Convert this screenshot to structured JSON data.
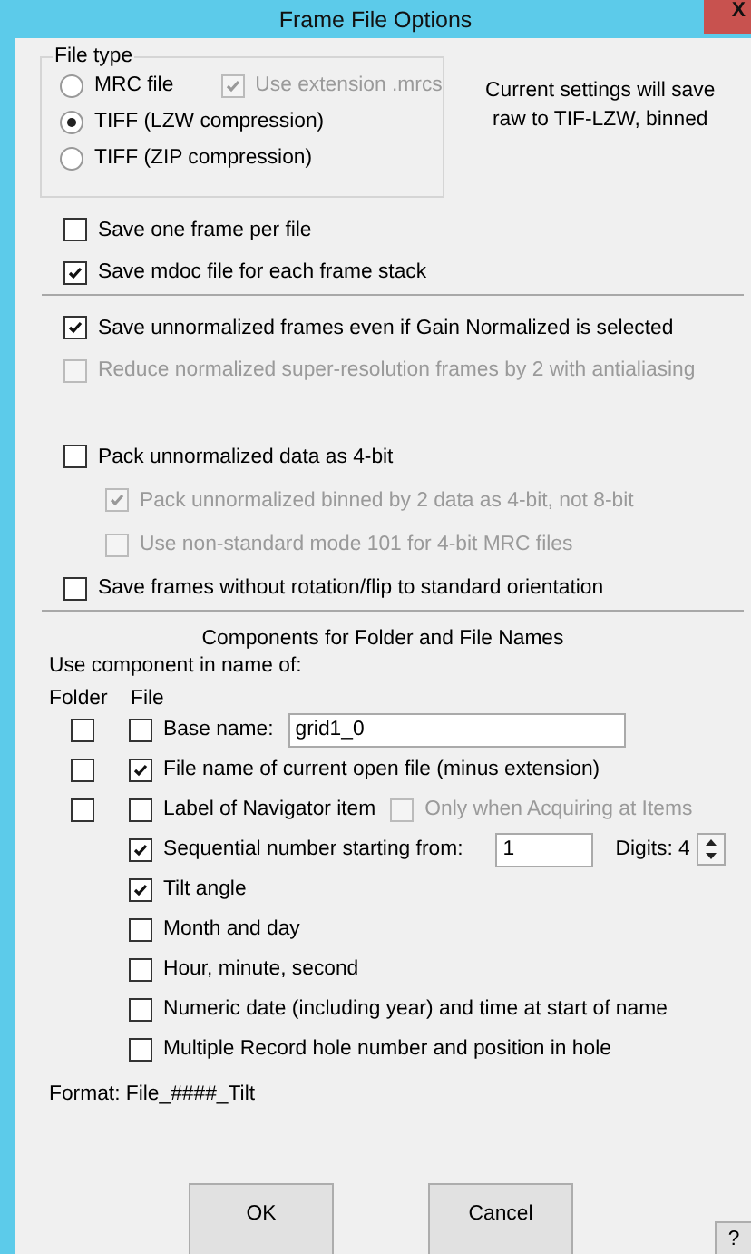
{
  "window": {
    "title": "Frame File Options",
    "close_label": "X"
  },
  "file_type": {
    "label": "File type",
    "options": [
      {
        "label": "MRC file",
        "selected": false
      },
      {
        "label": "TIFF (LZW compression)",
        "selected": true
      },
      {
        "label": "TIFF (ZIP compression)",
        "selected": false
      }
    ],
    "extension_option": {
      "label": "Use extension .mrcs",
      "checked": true,
      "disabled": true
    }
  },
  "settings_note": "Current settings will save raw to TIF-LZW, binned",
  "sections": [
    {
      "options": [
        {
          "label": "Save one frame per file",
          "checked": false,
          "disabled": false
        },
        {
          "label": "Save mdoc file for each frame stack",
          "checked": true,
          "disabled": false
        }
      ]
    },
    {
      "options": [
        {
          "label": "Save unnormalized frames even if Gain Normalized is selected",
          "checked": true,
          "disabled": false
        },
        {
          "label": "Reduce normalized super-resolution frames by 2 with antialiasing",
          "checked": false,
          "disabled": true
        },
        {
          "label": "Pack unnormalized data as 4-bit",
          "checked": false,
          "disabled": false,
          "children": [
            {
              "label": "Pack unnormalized binned by 2 data as 4-bit, not 8-bit",
              "checked": true,
              "disabled": true
            },
            {
              "label": "Use non-standard mode 101 for 4-bit MRC files",
              "checked": false,
              "disabled": true
            }
          ]
        },
        {
          "label": "Save frames without rotation/flip to standard orientation",
          "checked": false,
          "disabled": false
        }
      ]
    }
  ],
  "components": {
    "title": "Components for Folder and File Names",
    "subtitle": "Use component in name of:",
    "column_headers": [
      "Folder",
      "File"
    ],
    "rows": [
      {
        "kind": "text",
        "label": "Base name:",
        "folder_checked": false,
        "file_checked": false,
        "value": "grid1_0"
      },
      {
        "kind": "plain",
        "label": "File name of current open file (minus extension)",
        "folder_checked": false,
        "file_checked": true
      },
      {
        "kind": "extra",
        "label": "Label of Navigator item",
        "folder_checked": false,
        "file_checked": false,
        "extra": {
          "label": "Only when Acquiring at Items",
          "checked": false,
          "disabled": true
        }
      },
      {
        "kind": "number",
        "label": "Sequential number starting from:",
        "file_checked": true,
        "value": "1",
        "digits": "Digits: 4"
      },
      {
        "kind": "plain",
        "label": "Tilt angle",
        "file_checked": true
      },
      {
        "kind": "plain",
        "label": "Month and day",
        "file_checked": false
      },
      {
        "kind": "plain",
        "label": "Hour, minute, second",
        "file_checked": false
      },
      {
        "kind": "plain",
        "label": "Numeric date (including year) and time at start of name",
        "file_checked": false
      },
      {
        "kind": "plain",
        "label": "Multiple Record hole number and position in hole",
        "file_checked": false
      }
    ]
  },
  "format": "Format: File_####_Tilt",
  "buttons": [
    "OK",
    "Cancel"
  ],
  "help_label": "?"
}
